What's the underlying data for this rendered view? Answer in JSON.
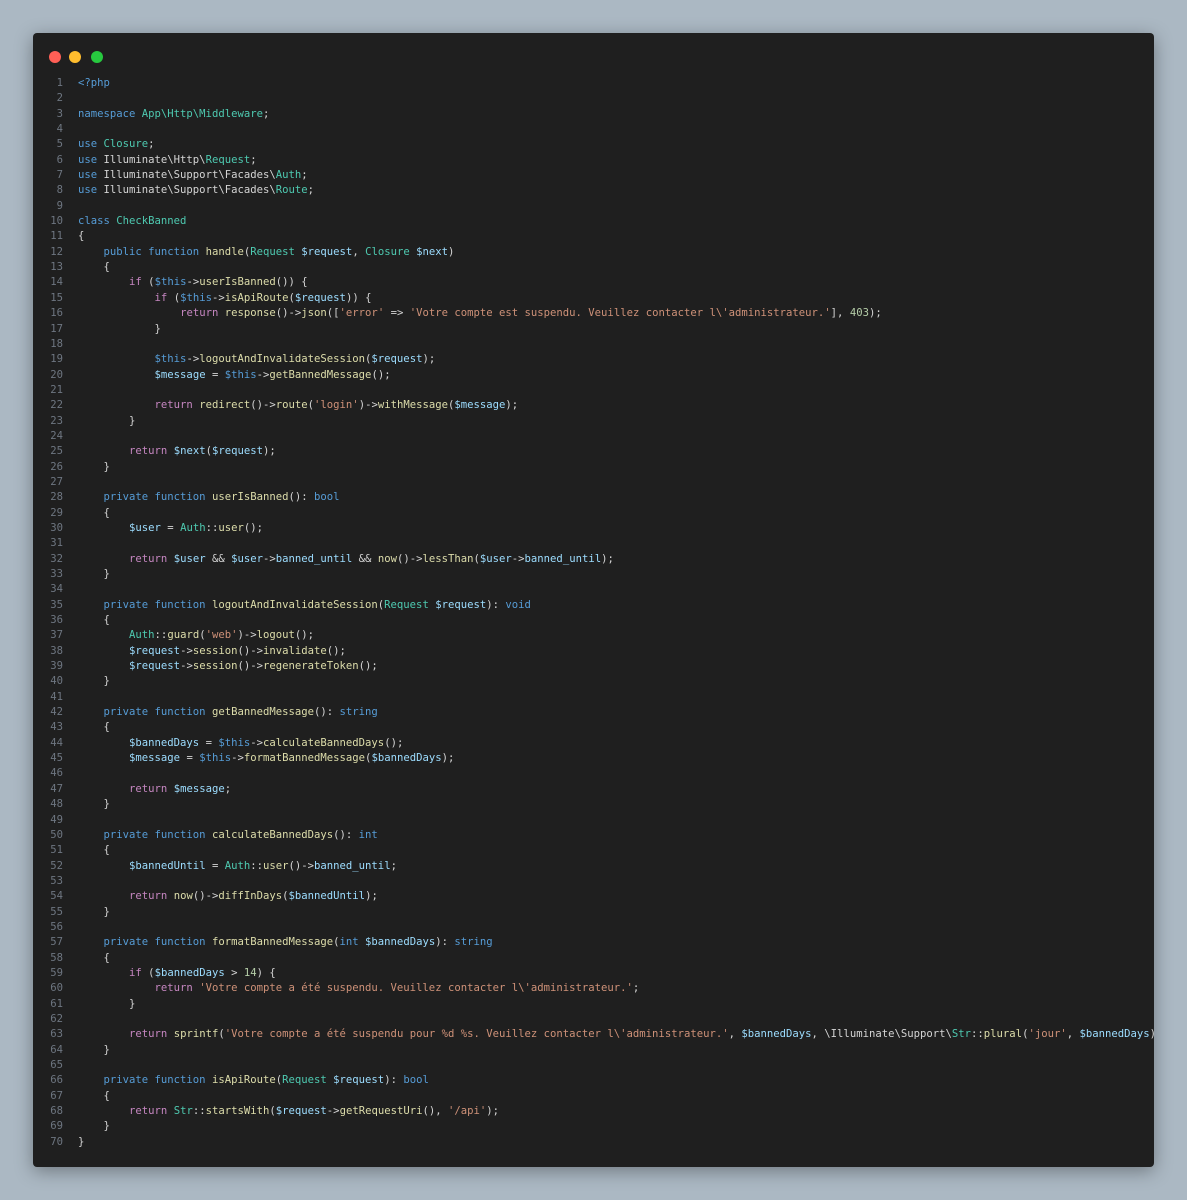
{
  "window": {
    "controls": [
      "close",
      "minimize",
      "maximize"
    ]
  },
  "editor": {
    "language": "php",
    "lines": [
      [
        [
          "k",
          "<?php"
        ]
      ],
      [],
      [
        [
          "k",
          "namespace "
        ],
        [
          "t",
          "App\\Http\\Middleware"
        ],
        [
          "p",
          ";"
        ]
      ],
      [],
      [
        [
          "k",
          "use "
        ],
        [
          "t",
          "Closure"
        ],
        [
          "p",
          ";"
        ]
      ],
      [
        [
          "k",
          "use "
        ],
        [
          "p",
          "Illuminate\\Http\\"
        ],
        [
          "t",
          "Request"
        ],
        [
          "p",
          ";"
        ]
      ],
      [
        [
          "k",
          "use "
        ],
        [
          "p",
          "Illuminate\\Support\\Facades\\"
        ],
        [
          "t",
          "Auth"
        ],
        [
          "p",
          ";"
        ]
      ],
      [
        [
          "k",
          "use "
        ],
        [
          "p",
          "Illuminate\\Support\\Facades\\"
        ],
        [
          "t",
          "Route"
        ],
        [
          "p",
          ";"
        ]
      ],
      [],
      [
        [
          "k",
          "class "
        ],
        [
          "t",
          "CheckBanned"
        ]
      ],
      [
        [
          "p",
          "{"
        ]
      ],
      [
        [
          "p",
          "    "
        ],
        [
          "k",
          "public function "
        ],
        [
          "f",
          "handle"
        ],
        [
          "p",
          "("
        ],
        [
          "t",
          "Request "
        ],
        [
          "v",
          "$request"
        ],
        [
          "p",
          ", "
        ],
        [
          "t",
          "Closure "
        ],
        [
          "v",
          "$next"
        ],
        [
          "p",
          ")"
        ]
      ],
      [
        [
          "p",
          "    {"
        ]
      ],
      [
        [
          "p",
          "        "
        ],
        [
          "c",
          "if "
        ],
        [
          "p",
          "("
        ],
        [
          "k",
          "$this"
        ],
        [
          "p",
          "->"
        ],
        [
          "f",
          "userIsBanned"
        ],
        [
          "p",
          "()) {"
        ]
      ],
      [
        [
          "p",
          "            "
        ],
        [
          "c",
          "if "
        ],
        [
          "p",
          "("
        ],
        [
          "k",
          "$this"
        ],
        [
          "p",
          "->"
        ],
        [
          "f",
          "isApiRoute"
        ],
        [
          "p",
          "("
        ],
        [
          "v",
          "$request"
        ],
        [
          "p",
          ")) {"
        ]
      ],
      [
        [
          "p",
          "                "
        ],
        [
          "c",
          "return "
        ],
        [
          "f",
          "response"
        ],
        [
          "p",
          "()->"
        ],
        [
          "f",
          "json"
        ],
        [
          "p",
          "(["
        ],
        [
          "s",
          "'error'"
        ],
        [
          "p",
          " => "
        ],
        [
          "s",
          "'Votre compte est suspendu. Veuillez contacter l\\'administrateur.'"
        ],
        [
          "p",
          "], "
        ],
        [
          "n",
          "403"
        ],
        [
          "p",
          ");"
        ]
      ],
      [
        [
          "p",
          "            }"
        ]
      ],
      [],
      [
        [
          "p",
          "            "
        ],
        [
          "k",
          "$this"
        ],
        [
          "p",
          "->"
        ],
        [
          "f",
          "logoutAndInvalidateSession"
        ],
        [
          "p",
          "("
        ],
        [
          "v",
          "$request"
        ],
        [
          "p",
          ");"
        ]
      ],
      [
        [
          "p",
          "            "
        ],
        [
          "v",
          "$message"
        ],
        [
          "p",
          " = "
        ],
        [
          "k",
          "$this"
        ],
        [
          "p",
          "->"
        ],
        [
          "f",
          "getBannedMessage"
        ],
        [
          "p",
          "();"
        ]
      ],
      [],
      [
        [
          "p",
          "            "
        ],
        [
          "c",
          "return "
        ],
        [
          "f",
          "redirect"
        ],
        [
          "p",
          "()->"
        ],
        [
          "f",
          "route"
        ],
        [
          "p",
          "("
        ],
        [
          "s",
          "'login'"
        ],
        [
          "p",
          ")->"
        ],
        [
          "f",
          "withMessage"
        ],
        [
          "p",
          "("
        ],
        [
          "v",
          "$message"
        ],
        [
          "p",
          ");"
        ]
      ],
      [
        [
          "p",
          "        }"
        ]
      ],
      [],
      [
        [
          "p",
          "        "
        ],
        [
          "c",
          "return "
        ],
        [
          "v",
          "$next"
        ],
        [
          "p",
          "("
        ],
        [
          "v",
          "$request"
        ],
        [
          "p",
          ");"
        ]
      ],
      [
        [
          "p",
          "    }"
        ]
      ],
      [],
      [
        [
          "p",
          "    "
        ],
        [
          "k",
          "private function "
        ],
        [
          "f",
          "userIsBanned"
        ],
        [
          "p",
          "(): "
        ],
        [
          "k",
          "bool"
        ]
      ],
      [
        [
          "p",
          "    {"
        ]
      ],
      [
        [
          "p",
          "        "
        ],
        [
          "v",
          "$user"
        ],
        [
          "p",
          " = "
        ],
        [
          "t",
          "Auth"
        ],
        [
          "p",
          "::"
        ],
        [
          "f",
          "user"
        ],
        [
          "p",
          "();"
        ]
      ],
      [],
      [
        [
          "p",
          "        "
        ],
        [
          "c",
          "return "
        ],
        [
          "v",
          "$user"
        ],
        [
          "p",
          " && "
        ],
        [
          "v",
          "$user"
        ],
        [
          "p",
          "->"
        ],
        [
          "v",
          "banned_until"
        ],
        [
          "p",
          " && "
        ],
        [
          "f",
          "now"
        ],
        [
          "p",
          "()->"
        ],
        [
          "f",
          "lessThan"
        ],
        [
          "p",
          "("
        ],
        [
          "v",
          "$user"
        ],
        [
          "p",
          "->"
        ],
        [
          "v",
          "banned_until"
        ],
        [
          "p",
          ");"
        ]
      ],
      [
        [
          "p",
          "    }"
        ]
      ],
      [],
      [
        [
          "p",
          "    "
        ],
        [
          "k",
          "private function "
        ],
        [
          "f",
          "logoutAndInvalidateSession"
        ],
        [
          "p",
          "("
        ],
        [
          "t",
          "Request "
        ],
        [
          "v",
          "$request"
        ],
        [
          "p",
          "): "
        ],
        [
          "k",
          "void"
        ]
      ],
      [
        [
          "p",
          "    {"
        ]
      ],
      [
        [
          "p",
          "        "
        ],
        [
          "t",
          "Auth"
        ],
        [
          "p",
          "::"
        ],
        [
          "f",
          "guard"
        ],
        [
          "p",
          "("
        ],
        [
          "s",
          "'web'"
        ],
        [
          "p",
          ")->"
        ],
        [
          "f",
          "logout"
        ],
        [
          "p",
          "();"
        ]
      ],
      [
        [
          "p",
          "        "
        ],
        [
          "v",
          "$request"
        ],
        [
          "p",
          "->"
        ],
        [
          "f",
          "session"
        ],
        [
          "p",
          "()->"
        ],
        [
          "f",
          "invalidate"
        ],
        [
          "p",
          "();"
        ]
      ],
      [
        [
          "p",
          "        "
        ],
        [
          "v",
          "$request"
        ],
        [
          "p",
          "->"
        ],
        [
          "f",
          "session"
        ],
        [
          "p",
          "()->"
        ],
        [
          "f",
          "regenerateToken"
        ],
        [
          "p",
          "();"
        ]
      ],
      [
        [
          "p",
          "    }"
        ]
      ],
      [],
      [
        [
          "p",
          "    "
        ],
        [
          "k",
          "private function "
        ],
        [
          "f",
          "getBannedMessage"
        ],
        [
          "p",
          "(): "
        ],
        [
          "k",
          "string"
        ]
      ],
      [
        [
          "p",
          "    {"
        ]
      ],
      [
        [
          "p",
          "        "
        ],
        [
          "v",
          "$bannedDays"
        ],
        [
          "p",
          " = "
        ],
        [
          "k",
          "$this"
        ],
        [
          "p",
          "->"
        ],
        [
          "f",
          "calculateBannedDays"
        ],
        [
          "p",
          "();"
        ]
      ],
      [
        [
          "p",
          "        "
        ],
        [
          "v",
          "$message"
        ],
        [
          "p",
          " = "
        ],
        [
          "k",
          "$this"
        ],
        [
          "p",
          "->"
        ],
        [
          "f",
          "formatBannedMessage"
        ],
        [
          "p",
          "("
        ],
        [
          "v",
          "$bannedDays"
        ],
        [
          "p",
          ");"
        ]
      ],
      [],
      [
        [
          "p",
          "        "
        ],
        [
          "c",
          "return "
        ],
        [
          "v",
          "$message"
        ],
        [
          "p",
          ";"
        ]
      ],
      [
        [
          "p",
          "    }"
        ]
      ],
      [],
      [
        [
          "p",
          "    "
        ],
        [
          "k",
          "private function "
        ],
        [
          "f",
          "calculateBannedDays"
        ],
        [
          "p",
          "(): "
        ],
        [
          "k",
          "int"
        ]
      ],
      [
        [
          "p",
          "    {"
        ]
      ],
      [
        [
          "p",
          "        "
        ],
        [
          "v",
          "$bannedUntil"
        ],
        [
          "p",
          " = "
        ],
        [
          "t",
          "Auth"
        ],
        [
          "p",
          "::"
        ],
        [
          "f",
          "user"
        ],
        [
          "p",
          "()->"
        ],
        [
          "v",
          "banned_until"
        ],
        [
          "p",
          ";"
        ]
      ],
      [],
      [
        [
          "p",
          "        "
        ],
        [
          "c",
          "return "
        ],
        [
          "f",
          "now"
        ],
        [
          "p",
          "()->"
        ],
        [
          "f",
          "diffInDays"
        ],
        [
          "p",
          "("
        ],
        [
          "v",
          "$bannedUntil"
        ],
        [
          "p",
          ");"
        ]
      ],
      [
        [
          "p",
          "    }"
        ]
      ],
      [],
      [
        [
          "p",
          "    "
        ],
        [
          "k",
          "private function "
        ],
        [
          "f",
          "formatBannedMessage"
        ],
        [
          "p",
          "("
        ],
        [
          "k",
          "int "
        ],
        [
          "v",
          "$bannedDays"
        ],
        [
          "p",
          "): "
        ],
        [
          "k",
          "string"
        ]
      ],
      [
        [
          "p",
          "    {"
        ]
      ],
      [
        [
          "p",
          "        "
        ],
        [
          "c",
          "if "
        ],
        [
          "p",
          "("
        ],
        [
          "v",
          "$bannedDays"
        ],
        [
          "p",
          " > "
        ],
        [
          "n",
          "14"
        ],
        [
          "p",
          ") {"
        ]
      ],
      [
        [
          "p",
          "            "
        ],
        [
          "c",
          "return "
        ],
        [
          "s",
          "'Votre compte a été suspendu. Veuillez contacter l\\'administrateur.'"
        ],
        [
          "p",
          ";"
        ]
      ],
      [
        [
          "p",
          "        }"
        ]
      ],
      [],
      [
        [
          "p",
          "        "
        ],
        [
          "c",
          "return "
        ],
        [
          "f",
          "sprintf"
        ],
        [
          "p",
          "("
        ],
        [
          "s",
          "'Votre compte a été suspendu pour %d %s. Veuillez contacter l\\'administrateur.'"
        ],
        [
          "p",
          ", "
        ],
        [
          "v",
          "$bannedDays"
        ],
        [
          "p",
          ", \\Illuminate\\Support\\"
        ],
        [
          "t",
          "Str"
        ],
        [
          "p",
          "::"
        ],
        [
          "f",
          "plural"
        ],
        [
          "p",
          "("
        ],
        [
          "s",
          "'jour'"
        ],
        [
          "p",
          ", "
        ],
        [
          "v",
          "$bannedDays"
        ],
        [
          "p",
          "));"
        ]
      ],
      [
        [
          "p",
          "    }"
        ]
      ],
      [],
      [
        [
          "p",
          "    "
        ],
        [
          "k",
          "private function "
        ],
        [
          "f",
          "isApiRoute"
        ],
        [
          "p",
          "("
        ],
        [
          "t",
          "Request "
        ],
        [
          "v",
          "$request"
        ],
        [
          "p",
          "): "
        ],
        [
          "k",
          "bool"
        ]
      ],
      [
        [
          "p",
          "    {"
        ]
      ],
      [
        [
          "p",
          "        "
        ],
        [
          "c",
          "return "
        ],
        [
          "t",
          "Str"
        ],
        [
          "p",
          "::"
        ],
        [
          "f",
          "startsWith"
        ],
        [
          "p",
          "("
        ],
        [
          "v",
          "$request"
        ],
        [
          "p",
          "->"
        ],
        [
          "f",
          "getRequestUri"
        ],
        [
          "p",
          "(), "
        ],
        [
          "s",
          "'/api'"
        ],
        [
          "p",
          ");"
        ]
      ],
      [
        [
          "p",
          "    }"
        ]
      ],
      [
        [
          "p",
          "}"
        ]
      ]
    ]
  }
}
